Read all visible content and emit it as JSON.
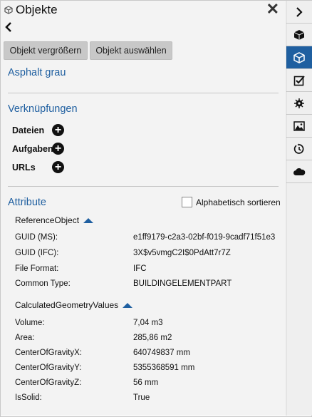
{
  "header": {
    "title": "Objekte"
  },
  "toolbar": {
    "zoom_label": "Objekt vergrößern",
    "select_label": "Objekt auswählen"
  },
  "object": {
    "name": "Asphalt grau"
  },
  "links": {
    "heading": "Verknüpfungen",
    "items": [
      {
        "label": "Dateien"
      },
      {
        "label": "Aufgaben"
      },
      {
        "label": "URLs"
      }
    ]
  },
  "attributes": {
    "heading": "Attribute",
    "sort_label": "Alphabetisch sortieren",
    "groups": [
      {
        "name": "ReferenceObject",
        "props": [
          {
            "key": "GUID (MS):",
            "value": "e1ff9179-c2a3-02bf-f019-9cadf71f51e3"
          },
          {
            "key": "GUID (IFC):",
            "value": "3X$v5vmgC2I$0PdAtt7r7Z"
          },
          {
            "key": "File Format:",
            "value": "IFC"
          },
          {
            "key": "Common Type:",
            "value": "BUILDINGELEMENTPART"
          }
        ]
      },
      {
        "name": "CalculatedGeometryValues",
        "props": [
          {
            "key": "Volume:",
            "value": "7,04 m3"
          },
          {
            "key": "Area:",
            "value": "285,86 m2"
          },
          {
            "key": "CenterOfGravityX:",
            "value": "640749837 mm"
          },
          {
            "key": "CenterOfGravityY:",
            "value": "5355368591 mm"
          },
          {
            "key": "CenterOfGravityZ:",
            "value": "56 mm"
          },
          {
            "key": "IsSolid:",
            "value": "True"
          }
        ]
      }
    ]
  },
  "colors": {
    "accent": "#1f5fa0",
    "panel_bg": "#f3f3f3",
    "button_bg": "#c8c8c8"
  },
  "rail": {
    "icons": [
      "chevron-right-icon",
      "cube-icon",
      "cube-outline-icon",
      "checklist-icon",
      "bug-icon",
      "image-icon",
      "history-icon",
      "cloud-icon"
    ],
    "active": "cube-outline-icon"
  }
}
